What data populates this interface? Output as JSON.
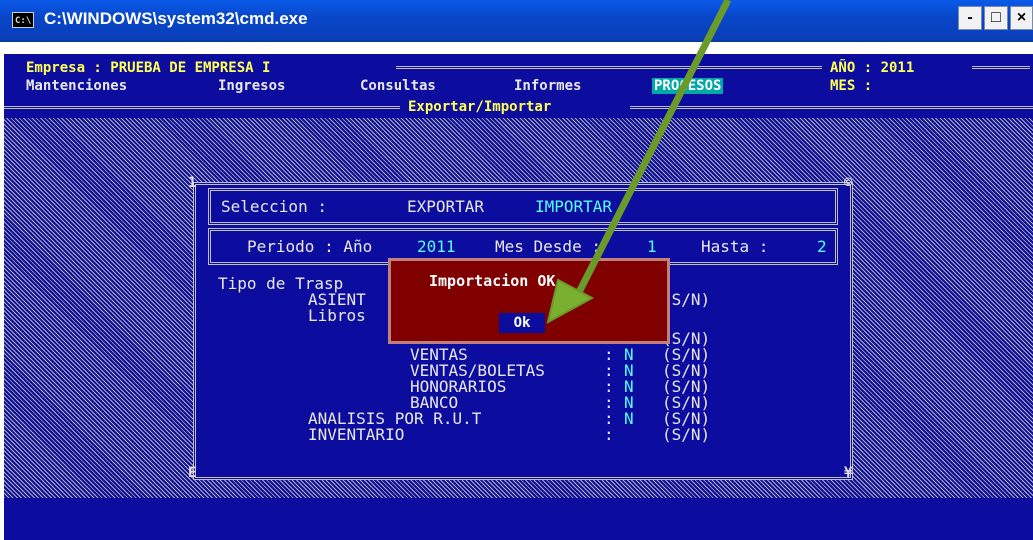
{
  "window": {
    "icon_text": "C:\\",
    "title": "C:\\WINDOWS\\system32\\cmd.exe",
    "min": "-",
    "max": "□",
    "close": "×"
  },
  "header": {
    "empresa_label": "Empresa : PRUEBA DE EMPRESA I",
    "anio_label": "AÑO : 2011",
    "mes_label": "MES :"
  },
  "menu": [
    "Mantenciones",
    "Ingresos",
    "Consultas",
    "Informes",
    "PROCESOS"
  ],
  "section_title": "Exportar/Importar",
  "dialog": {
    "seleccion_label": "Seleccion :",
    "exportar": "EXPORTAR",
    "importar": "IMPORTAR",
    "periodo_label": "Periodo : Año",
    "periodo_year": "2011",
    "mes_desde_label": "Mes Desde :",
    "mes_desde": "1",
    "hasta_label": "Hasta :",
    "hasta": "2",
    "tipo_label": "Tipo de Trasp",
    "asient": "ASIENT",
    "libros": "Libros",
    "sn": "(S/N)",
    "items": [
      {
        "label": "VENTAS",
        "value": "N"
      },
      {
        "label": "VENTAS/BOLETAS",
        "value": "N"
      },
      {
        "label": "HONORARIOS",
        "value": "N"
      },
      {
        "label": "BANCO",
        "value": "N"
      },
      {
        "label": "ANALISIS POR R.U.T",
        "value": "N"
      },
      {
        "label": "INVENTARIO",
        "value": ""
      }
    ]
  },
  "popup": {
    "title": "Importacion OK",
    "ok": "Ok"
  },
  "colors": {
    "console_bg": "#0c0c9e",
    "popup_bg": "#800000",
    "arrow": "#7ab030",
    "highlight": "#00a8a8"
  }
}
